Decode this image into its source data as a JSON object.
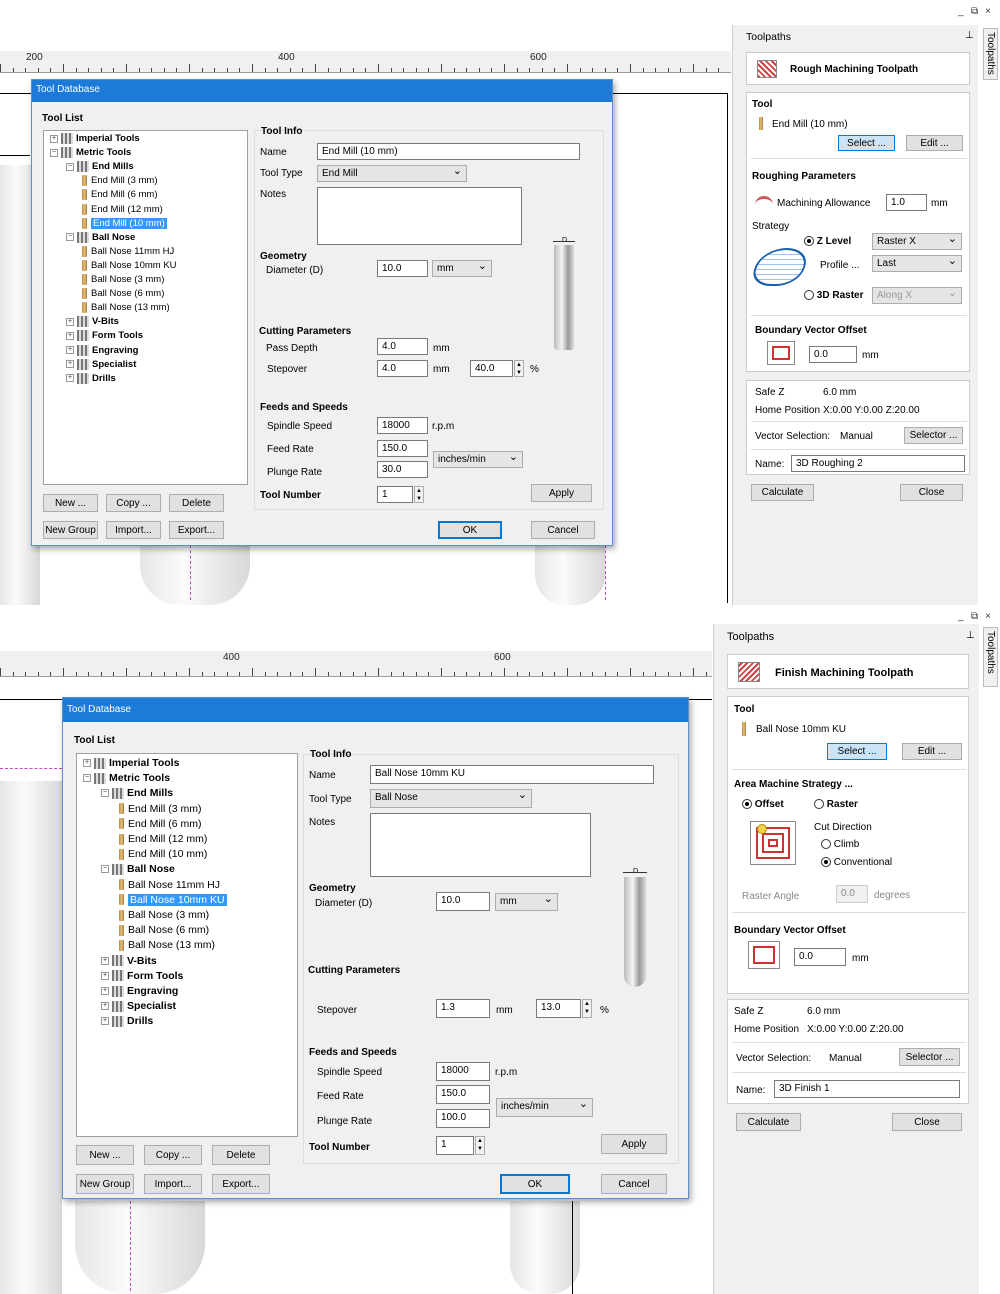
{
  "top": {
    "ruler": [
      "200",
      "400",
      "600"
    ],
    "window_controls": [
      "_",
      "⧉",
      "×"
    ],
    "dialog": {
      "title": "Tool Database",
      "tool_list_label": "Tool List",
      "tree": [
        {
          "label": "Imperial Tools",
          "bold": true,
          "level": 0,
          "exp": "+"
        },
        {
          "label": "Metric Tools",
          "bold": true,
          "level": 0,
          "exp": "−"
        },
        {
          "label": "End Mills",
          "bold": true,
          "level": 1,
          "exp": "−"
        },
        {
          "label": "End Mill (3 mm)",
          "level": 2
        },
        {
          "label": "End Mill (6 mm)",
          "level": 2
        },
        {
          "label": "End Mill (12 mm)",
          "level": 2
        },
        {
          "label": "End Mill (10 mm)",
          "level": 2,
          "selected": true
        },
        {
          "label": "Ball Nose",
          "bold": true,
          "level": 1,
          "exp": "−"
        },
        {
          "label": "Ball Nose 11mm HJ",
          "level": 2
        },
        {
          "label": "Ball Nose 10mm KU",
          "level": 2
        },
        {
          "label": "Ball Nose (3 mm)",
          "level": 2
        },
        {
          "label": "Ball Nose (6 mm)",
          "level": 2
        },
        {
          "label": "Ball Nose (13 mm)",
          "level": 2
        },
        {
          "label": "V-Bits",
          "bold": true,
          "level": 1,
          "exp": "+"
        },
        {
          "label": "Form Tools",
          "bold": true,
          "level": 1,
          "exp": "+"
        },
        {
          "label": "Engraving",
          "bold": true,
          "level": 1,
          "exp": "+"
        },
        {
          "label": "Specialist",
          "bold": true,
          "level": 1,
          "exp": "+"
        },
        {
          "label": "Drills",
          "bold": true,
          "level": 1,
          "exp": "+"
        }
      ],
      "buttons": {
        "new": "New ...",
        "copy": "Copy ...",
        "delete": "Delete",
        "new_group": "New Group",
        "import": "Import...",
        "export": "Export...",
        "apply": "Apply",
        "ok": "OK",
        "cancel": "Cancel"
      },
      "tool_info": {
        "label": "Tool Info",
        "name_label": "Name",
        "name": "End Mill (10 mm)",
        "type_label": "Tool Type",
        "type": "End Mill",
        "notes_label": "Notes",
        "geometry_label": "Geometry",
        "diameter_label": "Diameter (D)",
        "diameter": "10.0",
        "diameter_unit": "mm",
        "cutting_label": "Cutting Parameters",
        "pass_depth_label": "Pass Depth",
        "pass_depth": "4.0",
        "pass_depth_unit": "mm",
        "stepover_label": "Stepover",
        "stepover": "4.0",
        "stepover_unit": "mm",
        "stepover_pct": "40.0",
        "pct": "%",
        "feeds_label": "Feeds and Speeds",
        "spindle_label": "Spindle Speed",
        "spindle": "18000",
        "spindle_unit": "r.p.m",
        "feed_label": "Feed Rate",
        "feed": "150.0",
        "plunge_label": "Plunge Rate",
        "plunge": "30.0",
        "rate_unit": "inches/min",
        "tool_number_label": "Tool Number",
        "tool_number": "1",
        "diagram_d": "D"
      }
    },
    "sidebar": {
      "title": "Toolpaths",
      "pin": "⊥",
      "vtab": "Toolpaths",
      "header": "Rough Machining Toolpath",
      "tool_label": "Tool",
      "tool_name": "End Mill (10 mm)",
      "select_btn": "Select ...",
      "edit_btn": "Edit ...",
      "roughing_label": "Roughing Parameters",
      "allowance_label": "Machining Allowance",
      "allowance": "1.0",
      "allowance_unit": "mm",
      "strategy_label": "Strategy",
      "zlevel_label": "Z Level",
      "zlevel_select": "Raster X",
      "profile_label": "Profile ...",
      "profile_select": "Last",
      "raster3d_label": "3D Raster",
      "raster3d_select": "Along X",
      "bvo_label": "Boundary Vector Offset",
      "bvo": "0.0",
      "bvo_unit": "mm",
      "safe_z_label": "Safe Z",
      "safe_z": "6.0 mm",
      "home_label": "Home Position",
      "home": "X:0.00 Y:0.00 Z:20.00",
      "vector_sel_label": "Vector Selection:",
      "vector_sel": "Manual",
      "selector_btn": "Selector ...",
      "name_label": "Name:",
      "name": "3D Roughing 2",
      "calculate_btn": "Calculate",
      "close_btn": "Close"
    }
  },
  "bottom": {
    "ruler": [
      "400",
      "600"
    ],
    "window_controls": [
      "_",
      "⧉",
      "×"
    ],
    "dialog": {
      "title": "Tool Database",
      "tool_list_label": "Tool List",
      "tree": [
        {
          "label": "Imperial Tools",
          "bold": true,
          "level": 0,
          "exp": "+"
        },
        {
          "label": "Metric Tools",
          "bold": true,
          "level": 0,
          "exp": "−"
        },
        {
          "label": "End Mills",
          "bold": true,
          "level": 1,
          "exp": "−"
        },
        {
          "label": "End Mill (3 mm)",
          "level": 2
        },
        {
          "label": "End Mill (6 mm)",
          "level": 2
        },
        {
          "label": "End Mill (12 mm)",
          "level": 2
        },
        {
          "label": "End Mill (10 mm)",
          "level": 2
        },
        {
          "label": "Ball Nose",
          "bold": true,
          "level": 1,
          "exp": "−"
        },
        {
          "label": "Ball Nose 11mm HJ",
          "level": 2
        },
        {
          "label": "Ball Nose 10mm KU",
          "level": 2,
          "selected": true
        },
        {
          "label": "Ball Nose (3 mm)",
          "level": 2
        },
        {
          "label": "Ball Nose (6 mm)",
          "level": 2
        },
        {
          "label": "Ball Nose (13 mm)",
          "level": 2
        },
        {
          "label": "V-Bits",
          "bold": true,
          "level": 1,
          "exp": "+"
        },
        {
          "label": "Form Tools",
          "bold": true,
          "level": 1,
          "exp": "+"
        },
        {
          "label": "Engraving",
          "bold": true,
          "level": 1,
          "exp": "+"
        },
        {
          "label": "Specialist",
          "bold": true,
          "level": 1,
          "exp": "+"
        },
        {
          "label": "Drills",
          "bold": true,
          "level": 1,
          "exp": "+"
        }
      ],
      "buttons": {
        "new": "New ...",
        "copy": "Copy ...",
        "delete": "Delete",
        "new_group": "New Group",
        "import": "Import...",
        "export": "Export...",
        "apply": "Apply",
        "ok": "OK",
        "cancel": "Cancel"
      },
      "tool_info": {
        "label": "Tool Info",
        "name_label": "Name",
        "name": "Ball Nose 10mm KU",
        "type_label": "Tool Type",
        "type": "Ball Nose",
        "notes_label": "Notes",
        "geometry_label": "Geometry",
        "diameter_label": "Diameter (D)",
        "diameter": "10.0",
        "diameter_unit": "mm",
        "cutting_label": "Cutting Parameters",
        "stepover_label": "Stepover",
        "stepover": "1.3",
        "stepover_unit": "mm",
        "stepover_pct": "13.0",
        "pct": "%",
        "feeds_label": "Feeds and Speeds",
        "spindle_label": "Spindle Speed",
        "spindle": "18000",
        "spindle_unit": "r.p.m",
        "feed_label": "Feed Rate",
        "feed": "150.0",
        "plunge_label": "Plunge Rate",
        "plunge": "100.0",
        "rate_unit": "inches/min",
        "tool_number_label": "Tool Number",
        "tool_number": "1",
        "diagram_d": "D"
      }
    },
    "sidebar": {
      "title": "Toolpaths",
      "pin": "⊥",
      "vtab": "Toolpaths",
      "header": "Finish Machining Toolpath",
      "tool_label": "Tool",
      "tool_name": "Ball Nose 10mm KU",
      "select_btn": "Select ...",
      "edit_btn": "Edit ...",
      "strategy_label": "Area Machine Strategy ...",
      "offset_label": "Offset",
      "raster_label": "Raster",
      "cut_direction_label": "Cut Direction",
      "climb_label": "Climb",
      "conventional_label": "Conventional",
      "raster_angle_label": "Raster Angle",
      "raster_angle": "0.0",
      "raster_angle_unit": "degrees",
      "bvo_label": "Boundary Vector Offset",
      "bvo": "0.0",
      "bvo_unit": "mm",
      "safe_z_label": "Safe Z",
      "safe_z": "6.0 mm",
      "home_label": "Home Position",
      "home": "X:0.00 Y:0.00 Z:20.00",
      "vector_sel_label": "Vector Selection:",
      "vector_sel": "Manual",
      "selector_btn": "Selector ...",
      "name_label": "Name:",
      "name": "3D Finish 1",
      "calculate_btn": "Calculate",
      "close_btn": "Close"
    }
  }
}
